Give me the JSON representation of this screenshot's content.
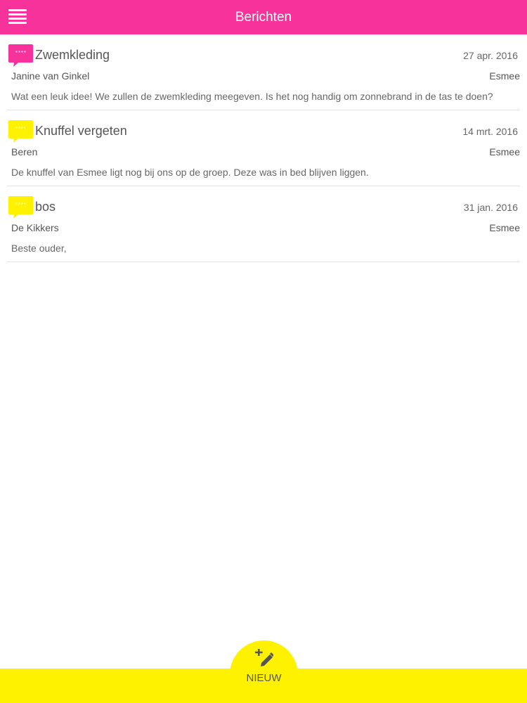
{
  "header": {
    "title": "Berichten",
    "menu_icon": "menu-icon",
    "background_color": "#f7339b"
  },
  "messages": [
    {
      "subject": "Zwemkleding",
      "date": "27 apr. 2016",
      "sender": "Janine van Ginkel",
      "child": "Esmee",
      "preview": "Wat een leuk idee! We zullen de zwemkleding meegeven. Is het nog handig om zonnebrand in de tas te doen?",
      "icon": "chat-bubble-icon",
      "icon_color": "#f7339b"
    },
    {
      "subject": "Knuffel vergeten",
      "date": "14 mrt. 2016",
      "sender": "Beren",
      "child": "Esmee",
      "preview": "De knuffel van Esmee ligt nog bij ons op de groep. Deze was in bed blijven liggen.",
      "icon": "chat-bubble-icon",
      "icon_color": "#fff200"
    },
    {
      "subject": "bos",
      "date": "31 jan. 2016",
      "sender": "De Kikkers",
      "child": "Esmee",
      "preview": "Beste ouder,",
      "icon": "chat-bubble-icon",
      "icon_color": "#fff200"
    }
  ],
  "footer": {
    "new_label": "NIEUW",
    "new_icon": "compose-icon",
    "background_color": "#fff200"
  }
}
